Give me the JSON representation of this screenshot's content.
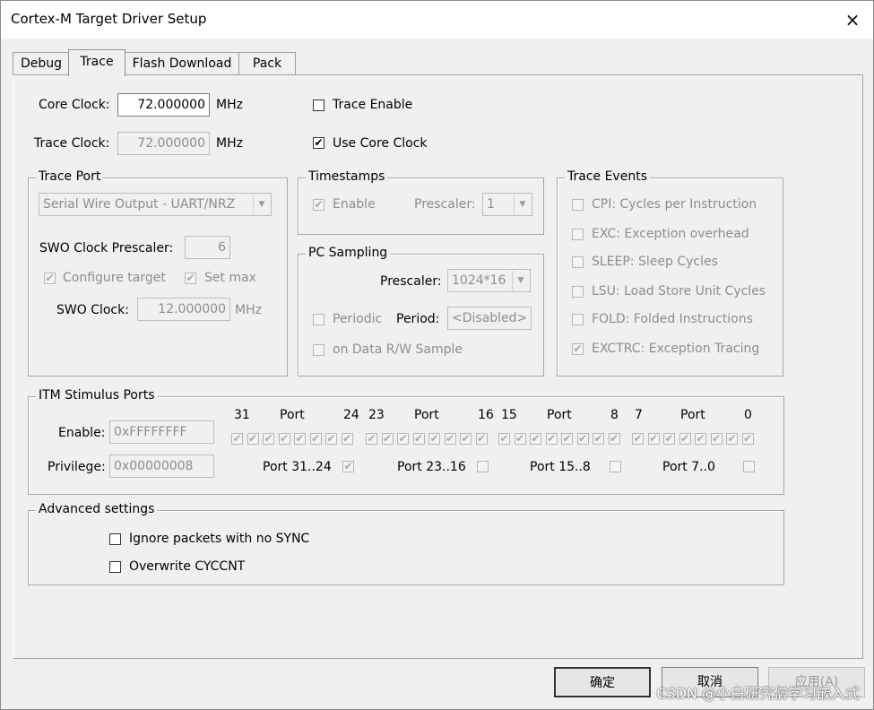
{
  "window": {
    "title": "Cortex-M Target Driver Setup",
    "close_glyph": "×"
  },
  "tabs": [
    {
      "label": "Debug"
    },
    {
      "label": "Trace"
    },
    {
      "label": "Flash Download"
    },
    {
      "label": "Pack"
    }
  ],
  "core_clock": {
    "label": "Core Clock:",
    "value": "72.000000",
    "unit": "MHz"
  },
  "trace_clock": {
    "label": "Trace Clock:",
    "value": "72.000000",
    "unit": "MHz"
  },
  "trace_enable": {
    "label": "Trace Enable",
    "checked": false
  },
  "use_core_clock": {
    "label": "Use Core Clock",
    "checked": true
  },
  "trace_port": {
    "title": "Trace Port",
    "selected": "Serial Wire Output - UART/NRZ",
    "swo_prescaler_label": "SWO Clock Prescaler:",
    "swo_prescaler_value": "6",
    "configure_target": {
      "label": "Configure target",
      "checked": true
    },
    "set_max": {
      "label": "Set max",
      "checked": true
    },
    "swo_clock_label": "SWO Clock:",
    "swo_clock_value": "12.000000",
    "swo_clock_unit": "MHz"
  },
  "timestamps": {
    "title": "Timestamps",
    "enable": {
      "label": "Enable",
      "checked": true
    },
    "prescaler_label": "Prescaler:",
    "prescaler_value": "1"
  },
  "pc_sampling": {
    "title": "PC Sampling",
    "prescaler_label": "Prescaler:",
    "prescaler_value": "1024*16",
    "periodic": {
      "label": "Periodic",
      "checked": false
    },
    "period_label": "Period:",
    "period_value": "<Disabled>",
    "on_data_rw": {
      "label": "on Data R/W Sample",
      "checked": false
    }
  },
  "trace_events": {
    "title": "Trace Events",
    "items": [
      {
        "label": "CPI: Cycles per Instruction",
        "checked": false
      },
      {
        "label": "EXC: Exception overhead",
        "checked": false
      },
      {
        "label": "SLEEP: Sleep Cycles",
        "checked": false
      },
      {
        "label": "LSU: Load Store Unit Cycles",
        "checked": false
      },
      {
        "label": "FOLD: Folded Instructions",
        "checked": false
      },
      {
        "label": "EXCTRC: Exception Tracing",
        "checked": true
      }
    ]
  },
  "itm": {
    "title": "ITM Stimulus Ports",
    "enable_label": "Enable:",
    "enable_value": "0xFFFFFFFF",
    "privilege_label": "Privilege:",
    "privilege_value": "0x00000008",
    "port_word": "Port",
    "groups": [
      {
        "hi": "31",
        "lo": "24",
        "priv_label": "Port 31..24",
        "priv_checked": true
      },
      {
        "hi": "23",
        "lo": "16",
        "priv_label": "Port 23..16",
        "priv_checked": false
      },
      {
        "hi": "15",
        "lo": "8",
        "priv_label": "Port 15..8",
        "priv_checked": false
      },
      {
        "hi": "7",
        "lo": "0",
        "priv_label": "Port 7..0",
        "priv_checked": false
      }
    ]
  },
  "advanced": {
    "title": "Advanced settings",
    "ignore_sync": {
      "label": "Ignore packets with no SYNC",
      "checked": false
    },
    "overwrite_cyccnt": {
      "label": "Overwrite CYCCNT",
      "checked": false
    }
  },
  "buttons": {
    "ok": "确定",
    "cancel": "取消",
    "apply": "应用(A)"
  },
  "watermark": "CSDN @小白研究僧学习嵌入式",
  "check_glyph": "✔"
}
